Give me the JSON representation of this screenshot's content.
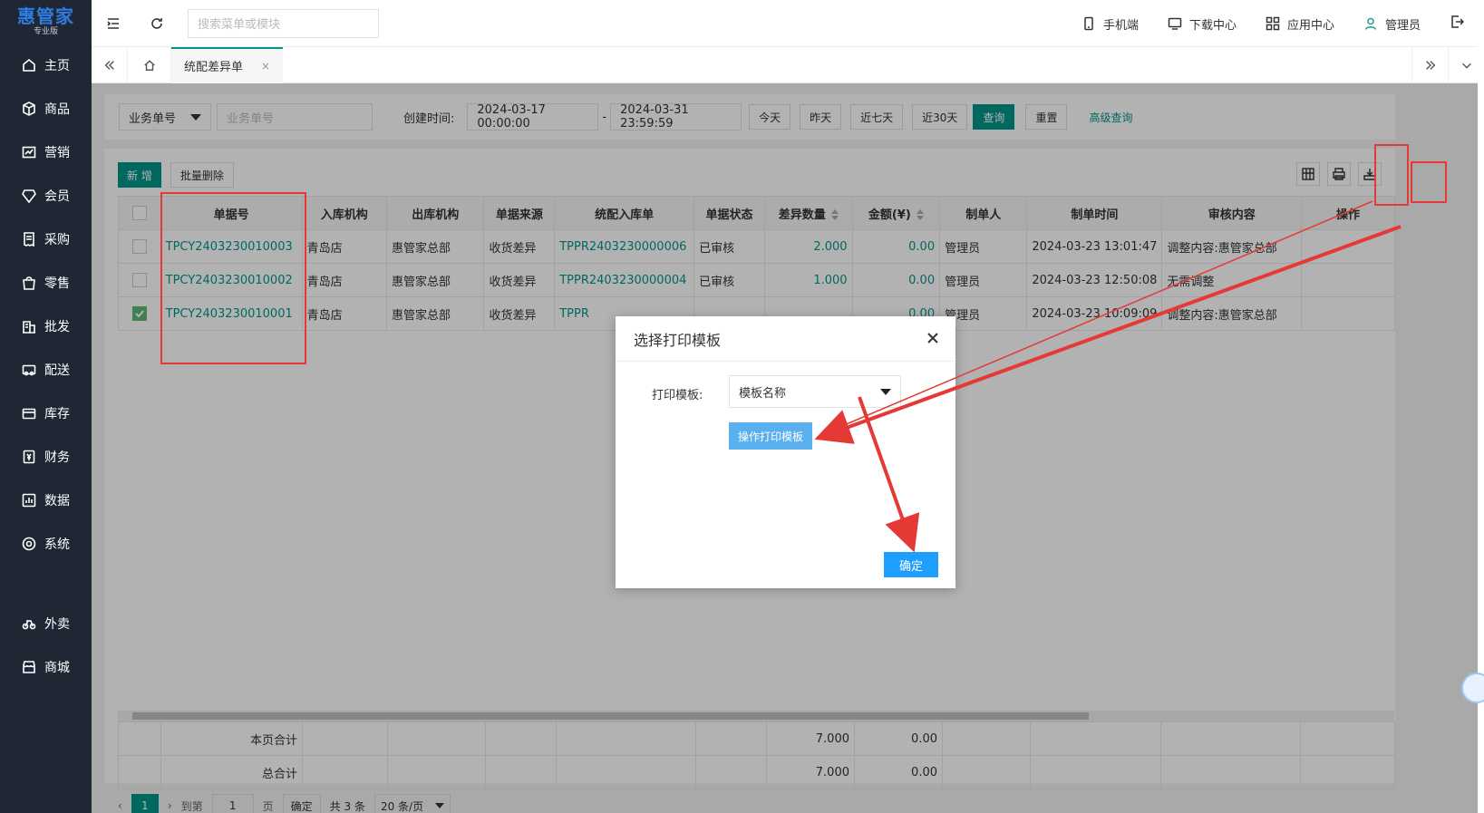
{
  "sidebar": {
    "logo": {
      "brand": "惠管家",
      "edition": "专业版"
    },
    "items": [
      {
        "label": "主页",
        "icon": "home-icon"
      },
      {
        "label": "商品",
        "icon": "box-icon"
      },
      {
        "label": "营销",
        "icon": "chart-icon"
      },
      {
        "label": "会员",
        "icon": "diamond-icon"
      },
      {
        "label": "采购",
        "icon": "receipt-icon"
      },
      {
        "label": "零售",
        "icon": "bag-icon"
      },
      {
        "label": "批发",
        "icon": "building-icon"
      },
      {
        "label": "配送",
        "icon": "truck-icon"
      },
      {
        "label": "库存",
        "icon": "warehouse-icon"
      },
      {
        "label": "财务",
        "icon": "wallet-icon"
      },
      {
        "label": "数据",
        "icon": "bar-chart-icon"
      },
      {
        "label": "系统",
        "icon": "settings-icon"
      },
      {
        "label": "外卖",
        "icon": "bike-icon"
      },
      {
        "label": "商城",
        "icon": "store-icon"
      }
    ]
  },
  "topbar": {
    "search_placeholder": "搜索菜单或模块",
    "mobile": "手机端",
    "download": "下载中心",
    "apps": "应用中心",
    "user": "管理员"
  },
  "tabs": {
    "active": "统配差异单",
    "close": "×"
  },
  "filter": {
    "type_select": "业务单号",
    "type_placeholder": "业务单号",
    "date_label": "创建时间:",
    "date_start": "2024-03-17 00:00:00",
    "date_sep": "-",
    "date_end": "2024-03-31 23:59:59",
    "today": "今天",
    "yesterday": "昨天",
    "last7": "近七天",
    "last30": "近30天",
    "query": "查询",
    "reset": "重置",
    "advanced": "高级查询"
  },
  "toolbar": {
    "add": "新 增",
    "batch_delete": "批量删除"
  },
  "table": {
    "headers": [
      "单据号",
      "入库机构",
      "出库机构",
      "单据来源",
      "统配入库单",
      "单据状态",
      "差异数量",
      "金额(¥)",
      "制单人",
      "制单时间",
      "审核内容",
      "操作"
    ],
    "rows": [
      {
        "checked": false,
        "cells": [
          "TPCY2403230010003",
          "青岛店",
          "惠管家总部",
          "收货差异",
          "TPPR2403230000006",
          "已审核",
          "2.000",
          "0.00",
          "管理员",
          "2024-03-23 13:01:47",
          "调整内容:惠管家总部",
          ""
        ]
      },
      {
        "checked": false,
        "cells": [
          "TPCY2403230010002",
          "青岛店",
          "惠管家总部",
          "收货差异",
          "TPPR2403230000004",
          "已审核",
          "1.000",
          "0.00",
          "管理员",
          "2024-03-23 12:50:08",
          "无需调整",
          ""
        ]
      },
      {
        "checked": true,
        "cells": [
          "TPCY2403230010001",
          "青岛店",
          "惠管家总部",
          "收货差异",
          "TPPR",
          "",
          "",
          "0.00",
          "管理员",
          "2024-03-23 10:09:09",
          "调整内容:惠管家总部",
          ""
        ]
      }
    ]
  },
  "totals": {
    "page_label": "本页合计",
    "page_qty": "7.000",
    "page_amt": "0.00",
    "all_label": "总合计",
    "all_qty": "7.000",
    "all_amt": "0.00"
  },
  "pager": {
    "current": "1",
    "goto": "到第",
    "page_input": "1",
    "page_unit": "页",
    "confirm": "确定",
    "total": "共 3 条",
    "size": "20 条/页"
  },
  "modal": {
    "title": "选择打印模板",
    "label": "打印模板:",
    "select_value": "模板名称",
    "template_button": "操作打印模板",
    "ok": "确定"
  },
  "colors": {
    "sidebar": "#1f2735",
    "accent": "#009688",
    "annotation": "#e53935",
    "modal_button": "#1e9fff"
  }
}
